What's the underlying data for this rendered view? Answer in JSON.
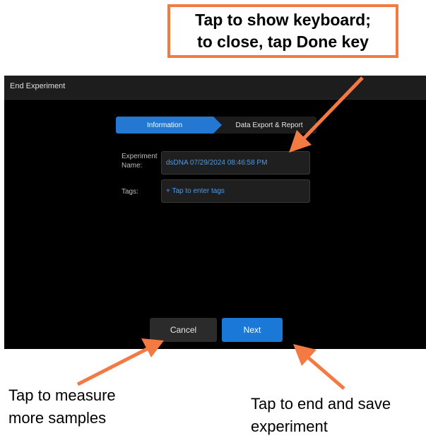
{
  "callouts": {
    "keyboard": "Tap to show keyboard;\nto close, tap Done key",
    "cancel": "Tap to measure\nmore samples",
    "next": "Tap to end and save\nexperiment"
  },
  "window": {
    "title": "End Experiment"
  },
  "steps": {
    "information": "Information",
    "export": "Data Export & Report"
  },
  "form": {
    "name_label": "Experiment\nName:",
    "name_value": "dsDNA 07/29/2024 08:46:58 PM",
    "tags_label": "Tags:",
    "tags_placeholder": "+ Tap to enter tags"
  },
  "buttons": {
    "cancel": "Cancel",
    "next": "Next"
  },
  "colors": {
    "callout_orange": "#f47a44",
    "accent_blue": "#1a78d6",
    "screen_bg": "#000000"
  }
}
